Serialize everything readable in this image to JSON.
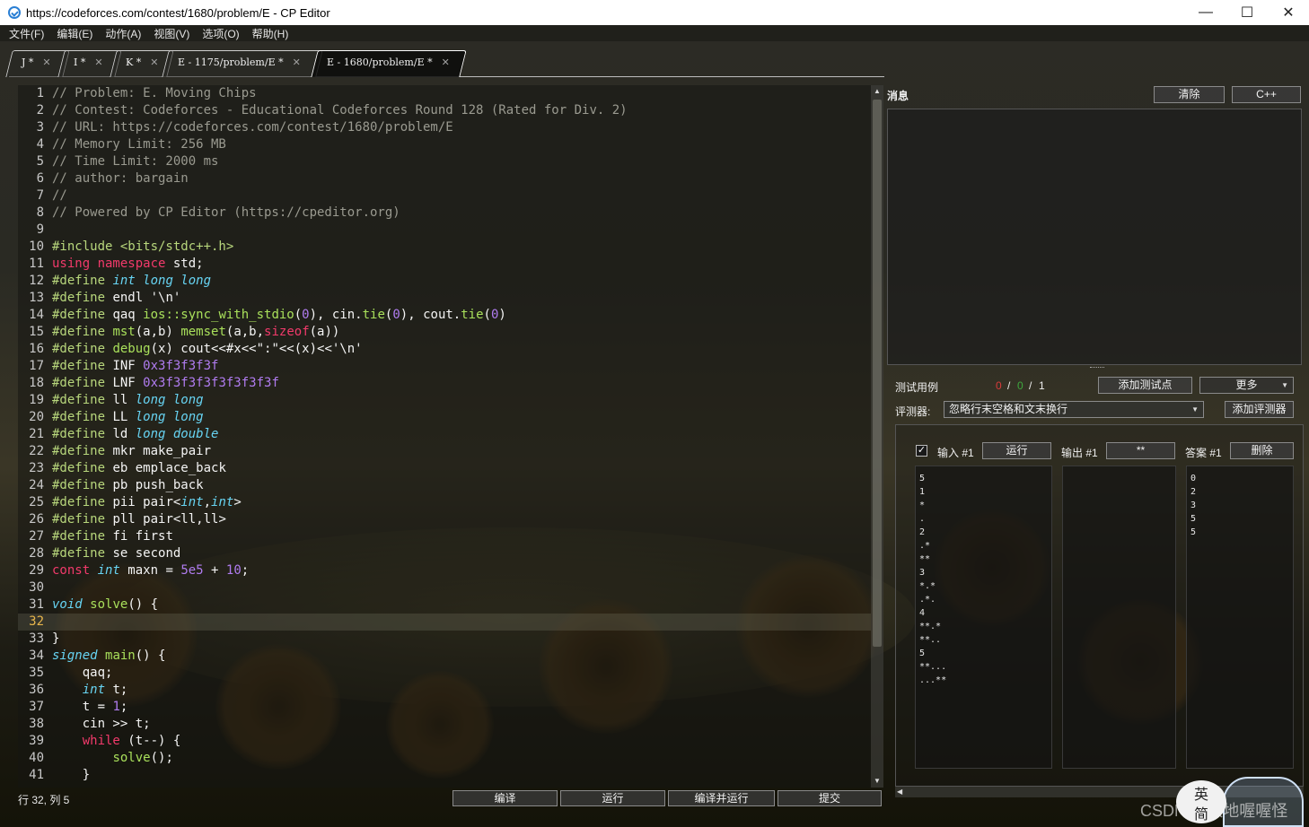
{
  "window": {
    "title": "https://codeforces.com/contest/1680/problem/E - CP Editor",
    "controls": [
      "—",
      "☐",
      "✕"
    ]
  },
  "menu": [
    "文件(F)",
    "编辑(E)",
    "动作(A)",
    "视图(V)",
    "选项(O)",
    "帮助(H)"
  ],
  "tabs": [
    {
      "label": "J *"
    },
    {
      "label": "I *"
    },
    {
      "label": "K *"
    },
    {
      "label": "E - 1175/problem/E *"
    },
    {
      "label": "E - 1680/problem/E *",
      "active": true
    }
  ],
  "tab_close_glyph": "✕",
  "editor": {
    "current_line": 32,
    "lines": [
      [
        [
          "c-com",
          "// Problem: E. Moving Chips"
        ]
      ],
      [
        [
          "c-com",
          "// Contest: Codeforces - Educational Codeforces Round 128 (Rated for Div. 2)"
        ]
      ],
      [
        [
          "c-com",
          "// URL: https://codeforces.com/contest/1680/problem/E"
        ]
      ],
      [
        [
          "c-com",
          "// Memory Limit: 256 MB"
        ]
      ],
      [
        [
          "c-com",
          "// Time Limit: 2000 ms"
        ]
      ],
      [
        [
          "c-com",
          "// author: bargain"
        ]
      ],
      [
        [
          "c-com",
          "//"
        ]
      ],
      [
        [
          "c-com",
          "// Powered by CP Editor (https://cpeditor.org)"
        ]
      ],
      [],
      [
        [
          "c-pre",
          "#include <bits/stdc++.h>"
        ]
      ],
      [
        [
          "c-kw",
          "using "
        ],
        [
          "c-kw",
          "namespace "
        ],
        [
          "c-pl",
          "std;"
        ]
      ],
      [
        [
          "c-pre",
          "#define "
        ],
        [
          "c-typ",
          "int long long"
        ]
      ],
      [
        [
          "c-pre",
          "#define "
        ],
        [
          "c-pl",
          "endl '\\n'"
        ]
      ],
      [
        [
          "c-pre",
          "#define "
        ],
        [
          "c-pl",
          "qaq "
        ],
        [
          "c-fn",
          "ios::sync_with_stdio"
        ],
        [
          "c-pl",
          "("
        ],
        [
          "c-num",
          "0"
        ],
        [
          "c-pl",
          "), cin."
        ],
        [
          "c-fn",
          "tie"
        ],
        [
          "c-pl",
          "("
        ],
        [
          "c-num",
          "0"
        ],
        [
          "c-pl",
          "), cout."
        ],
        [
          "c-fn",
          "tie"
        ],
        [
          "c-pl",
          "("
        ],
        [
          "c-num",
          "0"
        ],
        [
          "c-pl",
          ")"
        ]
      ],
      [
        [
          "c-pre",
          "#define "
        ],
        [
          "c-fn",
          "mst"
        ],
        [
          "c-pl",
          "(a,b) "
        ],
        [
          "c-fn",
          "memset"
        ],
        [
          "c-pl",
          "(a,b,"
        ],
        [
          "c-kw",
          "sizeof"
        ],
        [
          "c-pl",
          "(a))"
        ]
      ],
      [
        [
          "c-pre",
          "#define "
        ],
        [
          "c-fn",
          "debug"
        ],
        [
          "c-pl",
          "(x) cout<<#x<<\":\"<<(x)<<'\\n'"
        ]
      ],
      [
        [
          "c-pre",
          "#define "
        ],
        [
          "c-pl",
          "INF "
        ],
        [
          "c-num",
          "0x3f3f3f3f"
        ]
      ],
      [
        [
          "c-pre",
          "#define "
        ],
        [
          "c-pl",
          "LNF "
        ],
        [
          "c-num",
          "0x3f3f3f3f3f3f3f3f"
        ]
      ],
      [
        [
          "c-pre",
          "#define "
        ],
        [
          "c-pl",
          "ll "
        ],
        [
          "c-typ",
          "long long"
        ]
      ],
      [
        [
          "c-pre",
          "#define "
        ],
        [
          "c-pl",
          "LL "
        ],
        [
          "c-typ",
          "long long"
        ]
      ],
      [
        [
          "c-pre",
          "#define "
        ],
        [
          "c-pl",
          "ld "
        ],
        [
          "c-typ",
          "long double"
        ]
      ],
      [
        [
          "c-pre",
          "#define "
        ],
        [
          "c-pl",
          "mkr make_pair"
        ]
      ],
      [
        [
          "c-pre",
          "#define "
        ],
        [
          "c-pl",
          "eb emplace_back"
        ]
      ],
      [
        [
          "c-pre",
          "#define "
        ],
        [
          "c-pl",
          "pb push_back"
        ]
      ],
      [
        [
          "c-pre",
          "#define "
        ],
        [
          "c-pl",
          "pii pair<"
        ],
        [
          "c-typ",
          "int"
        ],
        [
          "c-pl",
          ","
        ],
        [
          "c-typ",
          "int"
        ],
        [
          "c-pl",
          ">"
        ]
      ],
      [
        [
          "c-pre",
          "#define "
        ],
        [
          "c-pl",
          "pll pair<ll,ll>"
        ]
      ],
      [
        [
          "c-pre",
          "#define "
        ],
        [
          "c-pl",
          "fi first"
        ]
      ],
      [
        [
          "c-pre",
          "#define "
        ],
        [
          "c-pl",
          "se second"
        ]
      ],
      [
        [
          "c-kw",
          "const "
        ],
        [
          "c-typ",
          "int "
        ],
        [
          "c-pl",
          "maxn = "
        ],
        [
          "c-num",
          "5e5"
        ],
        [
          "c-pl",
          " + "
        ],
        [
          "c-num",
          "10"
        ],
        [
          "c-pl",
          ";"
        ]
      ],
      [],
      [
        [
          "c-typ",
          "void "
        ],
        [
          "c-fn",
          "solve"
        ],
        [
          "c-pl",
          "() {"
        ]
      ],
      [],
      [
        [
          "c-pl",
          "}"
        ]
      ],
      [
        [
          "c-typ",
          "signed "
        ],
        [
          "c-fn",
          "main"
        ],
        [
          "c-pl",
          "() {"
        ]
      ],
      [
        [
          "c-pl",
          "    qaq;"
        ]
      ],
      [
        [
          "c-pl",
          "    "
        ],
        [
          "c-typ",
          "int "
        ],
        [
          "c-pl",
          "t;"
        ]
      ],
      [
        [
          "c-pl",
          "    t = "
        ],
        [
          "c-num",
          "1"
        ],
        [
          "c-pl",
          ";"
        ]
      ],
      [
        [
          "c-pl",
          "    cin >> t;"
        ]
      ],
      [
        [
          "c-pl",
          "    "
        ],
        [
          "c-kw",
          "while "
        ],
        [
          "c-pl",
          "(t--) {"
        ]
      ],
      [
        [
          "c-pl",
          "        "
        ],
        [
          "c-fn",
          "solve"
        ],
        [
          "c-pl",
          "();"
        ]
      ],
      [
        [
          "c-pl",
          "    }"
        ]
      ]
    ]
  },
  "status": {
    "position": "行 32, 列 5",
    "buttons": [
      "编译",
      "运行",
      "编译并运行",
      "提交"
    ]
  },
  "messages": {
    "label": "消息",
    "clear": "清除",
    "lang": "C++"
  },
  "tests": {
    "label": "测试用例",
    "passed": "0",
    "failed": "0",
    "sep": "/",
    "total": "1",
    "add_test": "添加测试点",
    "more": "更多",
    "checker_label": "评测器:",
    "checker_value": "忽略行末空格和文末换行",
    "add_checker": "添加评测器",
    "checked": "✓",
    "input_label": "输入 #1",
    "run": "运行",
    "output_label": "输出 #1",
    "diff": "**",
    "answer_label": "答案 #1",
    "delete": "删除",
    "input_value": "5\n1\n*\n.\n2\n.*\n**\n3\n*.*\n.*.\n4\n**.*\n**..\n5\n**...\n...**",
    "output_value": "",
    "answer_value": "0\n2\n3\n5\n5"
  },
  "overlay": {
    "watermark": "CSDN @伏地喔喔怪",
    "ime_lines": [
      "英",
      "简"
    ]
  }
}
